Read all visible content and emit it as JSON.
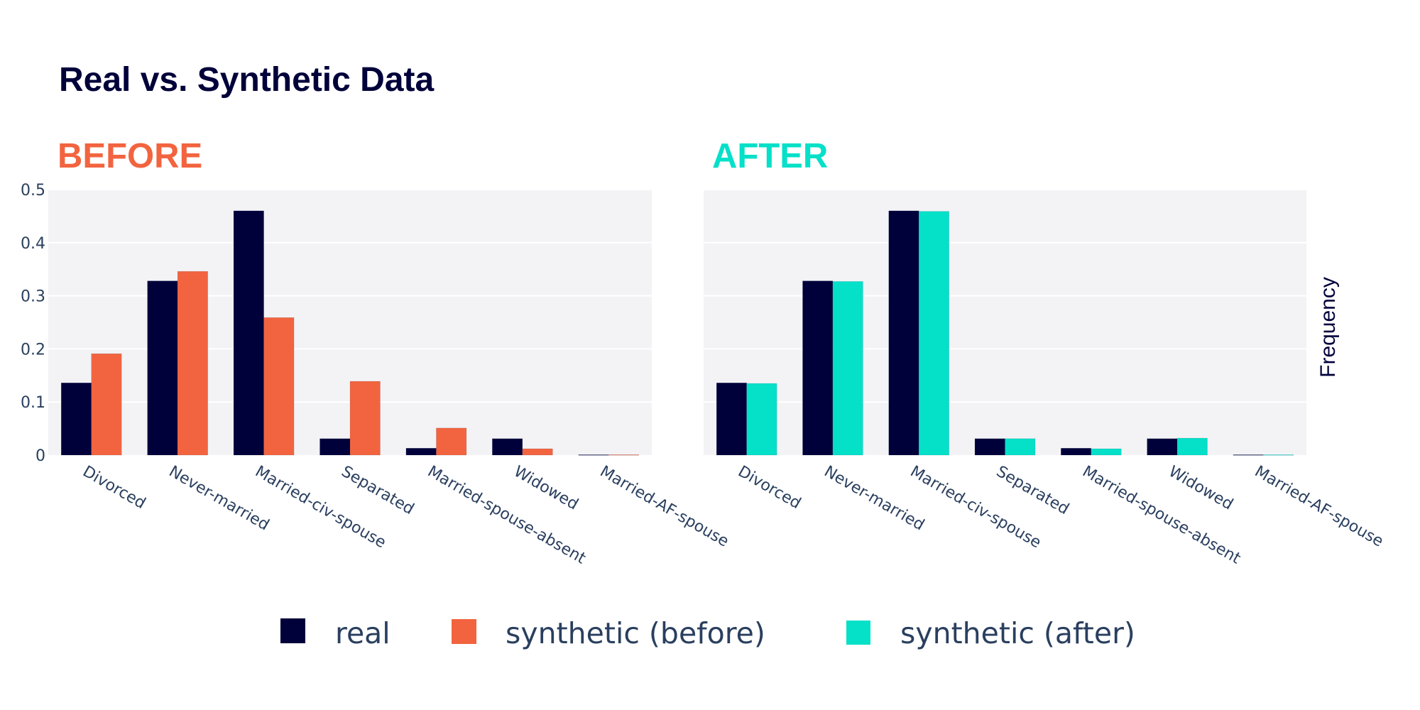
{
  "chart_data": {
    "type": "bar",
    "title": "Real vs. Synthetic Data",
    "ylabel": "Frequency",
    "ylim": [
      0,
      0.5
    ],
    "yticks": [
      "0",
      "0.1",
      "0.2",
      "0.3",
      "0.4",
      "0.5"
    ],
    "ytick_values": [
      0,
      0.1,
      0.2,
      0.3,
      0.4,
      0.5
    ],
    "grid": true,
    "legend_position": "bottom-center",
    "categories": [
      "Divorced",
      "Never-married",
      "Married-civ-spouse",
      "Separated",
      "Married-spouse-absent",
      "Widowed",
      "Married-AF-spouse"
    ],
    "panels": [
      {
        "title": "BEFORE",
        "title_color": "#f2643f",
        "series": [
          {
            "name": "real",
            "color": "#00003a",
            "values": [
              0.136,
              0.328,
              0.46,
              0.031,
              0.013,
              0.031,
              0.0007
            ]
          },
          {
            "name": "synthetic (before)",
            "color": "#f2643f",
            "values": [
              0.191,
              0.346,
              0.259,
              0.139,
              0.051,
              0.012,
              0.0008
            ]
          }
        ]
      },
      {
        "title": "AFTER",
        "title_color": "#05e0c8",
        "series": [
          {
            "name": "real",
            "color": "#00003a",
            "values": [
              0.136,
              0.328,
              0.46,
              0.031,
              0.013,
              0.031,
              0.0007
            ]
          },
          {
            "name": "synthetic (after)",
            "color": "#05e0c8",
            "values": [
              0.135,
              0.327,
              0.459,
              0.031,
              0.012,
              0.032,
              0.0007
            ]
          }
        ]
      }
    ],
    "legend": [
      {
        "name": "real",
        "color": "#00003a"
      },
      {
        "name": "synthetic (before)",
        "color": "#f2643f"
      },
      {
        "name": "synthetic (after)",
        "color": "#05e0c8"
      }
    ]
  },
  "colors": {
    "plot_background": "#f3f3f6",
    "gridline": "#ffffff",
    "tick_text": "#2a3f5f",
    "title_text": "#00003a"
  }
}
